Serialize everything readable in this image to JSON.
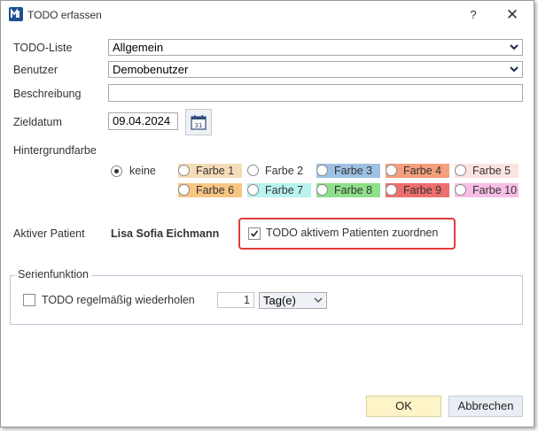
{
  "window": {
    "title": "TODO erfassen",
    "help_label": "?",
    "close_label": "✕"
  },
  "form": {
    "todo_list": {
      "label": "TODO-Liste",
      "value": "Allgemein"
    },
    "user": {
      "label": "Benutzer",
      "value": "Demobenutzer"
    },
    "description": {
      "label": "Beschreibung",
      "value": ""
    },
    "due_date": {
      "label": "Zieldatum",
      "value": "09.04.2024",
      "calendar_day": "31"
    },
    "background": {
      "label": "Hintergrundfarbe",
      "none_label": "keine",
      "none_selected": true,
      "colors": [
        {
          "label": "Farbe 1",
          "color": "#f5dcb8"
        },
        {
          "label": "Farbe 2",
          "color": "#ffffff"
        },
        {
          "label": "Farbe 3",
          "color": "#9ec1e3"
        },
        {
          "label": "Farbe 4",
          "color": "#f59f7c"
        },
        {
          "label": "Farbe 5",
          "color": "#fde3e0"
        },
        {
          "label": "Farbe 6",
          "color": "#f8c583"
        },
        {
          "label": "Farbe 7",
          "color": "#b8f3ee"
        },
        {
          "label": "Farbe 8",
          "color": "#8ee08a"
        },
        {
          "label": "Farbe 9",
          "color": "#ee6e6e"
        },
        {
          "label": "Farbe 10",
          "color": "#f7bfe6"
        }
      ]
    },
    "patient": {
      "label": "Aktiver Patient",
      "name": "Lisa Sofia Eichmann",
      "assign_label": "TODO aktivem Patienten zuordnen",
      "assign_checked": true
    }
  },
  "series": {
    "legend": "Serienfunktion",
    "repeat_label": "TODO regelmäßig wiederholen",
    "repeat_checked": false,
    "interval_value": "1",
    "unit_value": "Tag(e)"
  },
  "buttons": {
    "ok": "OK",
    "cancel": "Abbrechen"
  }
}
